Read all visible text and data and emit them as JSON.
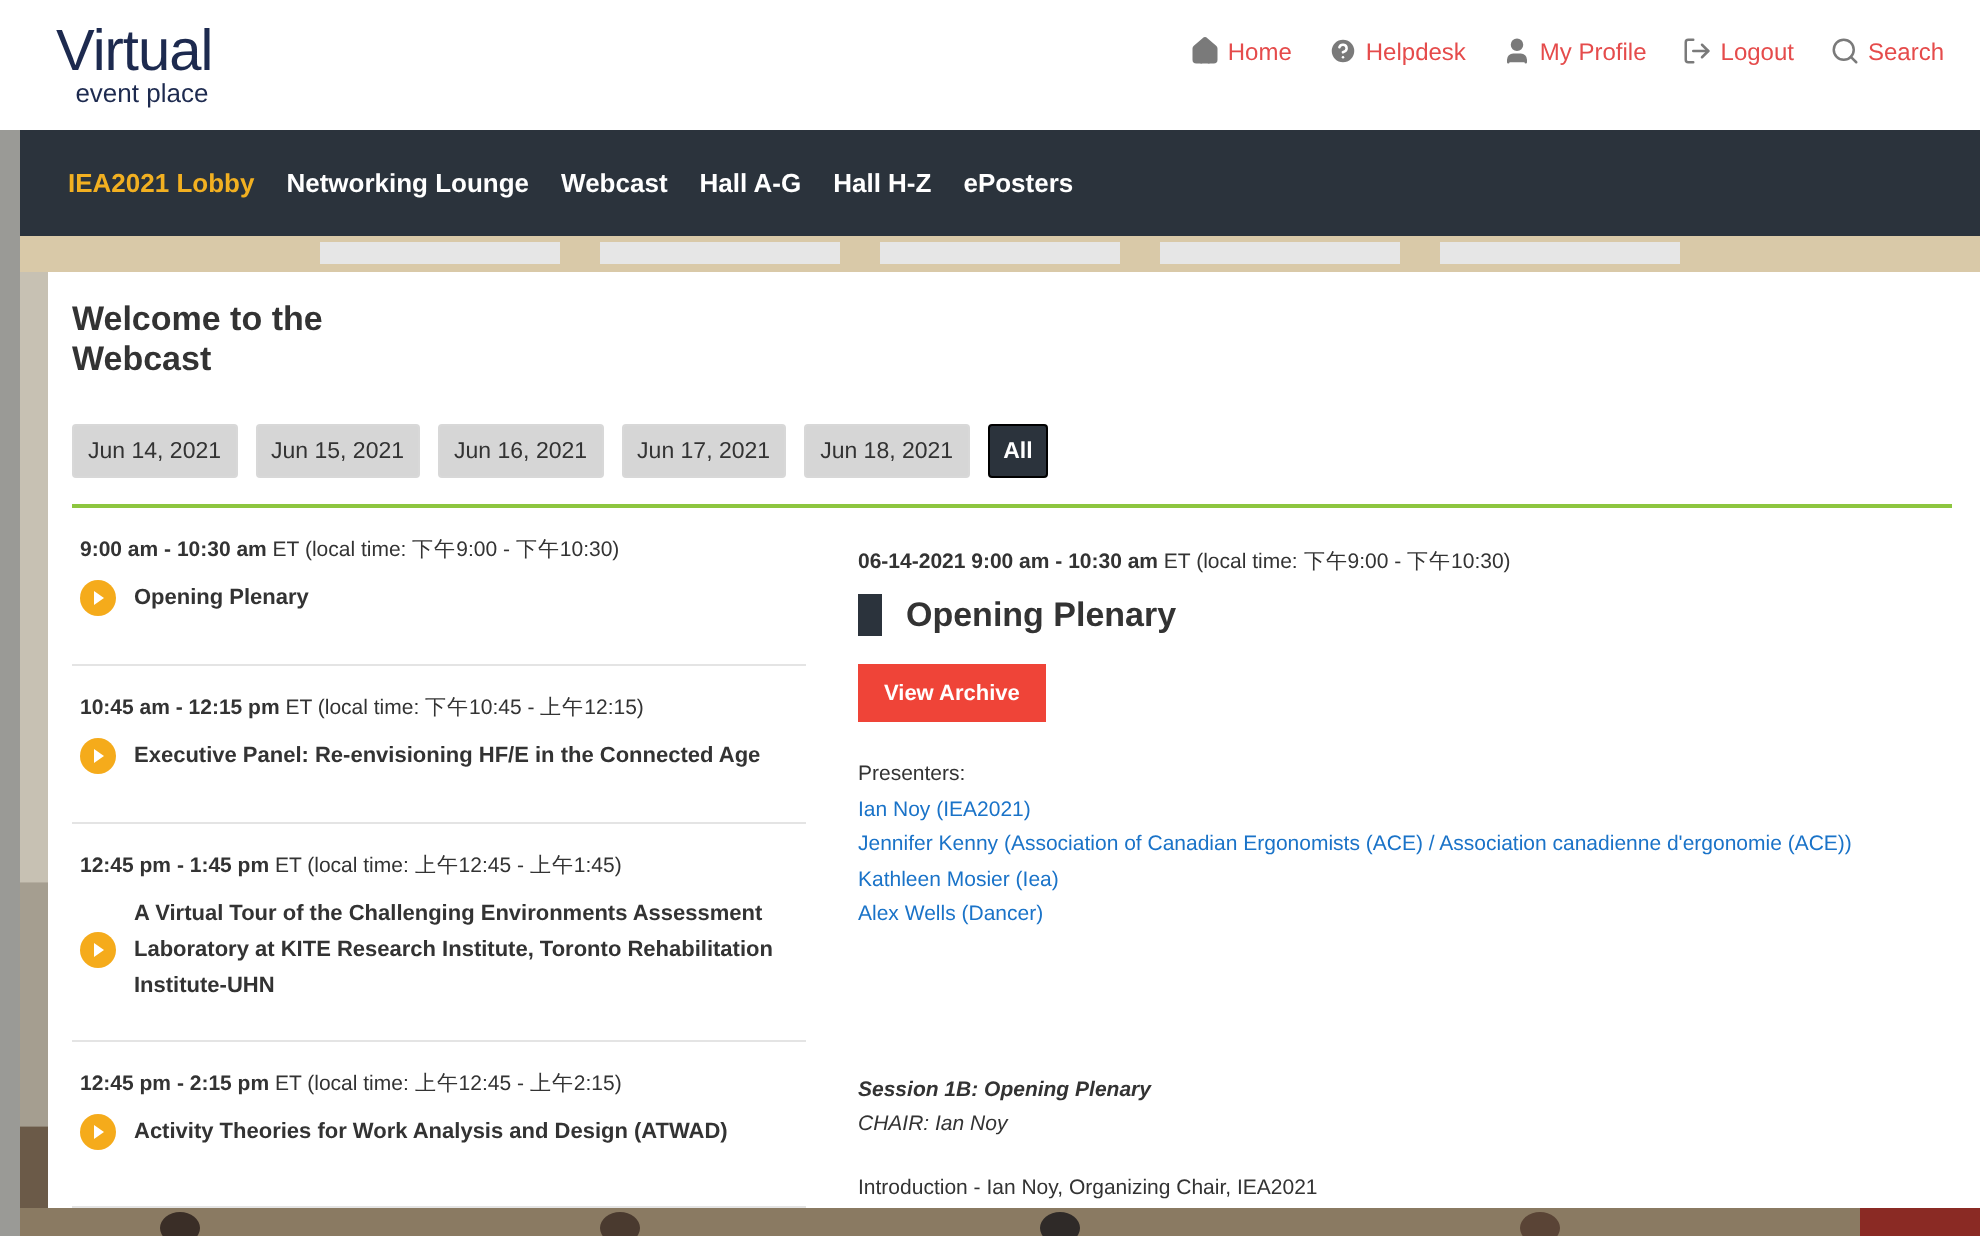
{
  "header": {
    "logo": {
      "word": "Virtual",
      "tagline": "event place"
    },
    "links": [
      {
        "label": "Home",
        "kind": "home"
      },
      {
        "label": "Helpdesk",
        "kind": "help"
      },
      {
        "label": "My Profile",
        "kind": "user"
      },
      {
        "label": "Logout",
        "kind": "logout"
      },
      {
        "label": "Search",
        "kind": "search"
      }
    ]
  },
  "nav": [
    {
      "label": "IEA2021 Lobby",
      "selected": true
    },
    {
      "label": "Networking Lounge",
      "selected": false
    },
    {
      "label": "Webcast",
      "selected": false
    },
    {
      "label": "Hall A-G",
      "selected": false
    },
    {
      "label": "Hall H-Z",
      "selected": false
    },
    {
      "label": "ePosters",
      "selected": false
    }
  ],
  "page_title": "Welcome to the Webcast",
  "date_filters": [
    {
      "label": "Jun 14, 2021",
      "selected": false
    },
    {
      "label": "Jun 15, 2021",
      "selected": false
    },
    {
      "label": "Jun 16, 2021",
      "selected": false
    },
    {
      "label": "Jun 17, 2021",
      "selected": false
    },
    {
      "label": "Jun 18, 2021",
      "selected": false
    },
    {
      "label": "All",
      "selected": true
    }
  ],
  "sessions": [
    {
      "time": "**9:00 am - 10:30 am**  ET   (local time: 下午9:00 - 下午10:30)",
      "title": "Opening Plenary"
    },
    {
      "time": "**10:45 am - 12:15 pm**  ET   (local time: 下午10:45 - 上午12:15)",
      "title": "Executive Panel: Re-envisioning HF/E in the Connected Age"
    },
    {
      "time": "**12:45 pm - 1:45 pm**  ET   (local time: 上午12:45 - 上午1:45)",
      "title": "A Virtual Tour of the Challenging Environments Assessment Laboratory at KITE Research Institute, Toronto Rehabilitation Institute-UHN"
    },
    {
      "time": "**12:45 pm - 2:15 pm**  ET   (local time: 上午12:45 - 上午2:15)",
      "title": "Activity Theories for Work Analysis and Design (ATWAD)"
    }
  ],
  "detail": {
    "when": "**06-14-2021  9:00 am - 10:30 am** ET  (local time: 下午9:00 - 下午10:30)",
    "title": "Opening Plenary",
    "button": "View Archive",
    "presenters_label": "Presenters:",
    "presenters": [
      "Ian Noy (IEA2021)",
      "Jennifer Kenny (Association of Canadian Ergonomists (ACE) / Association canadienne d'ergonomie (ACE))",
      "Kathleen Mosier (Iea)",
      "Alex Wells (Dancer)"
    ],
    "session": "Session 1B: Opening Plenary",
    "chair": "CHAIR: Ian Noy",
    "intro": "Introduction - Ian Noy, Organizing Chair, IEA2021"
  }
}
